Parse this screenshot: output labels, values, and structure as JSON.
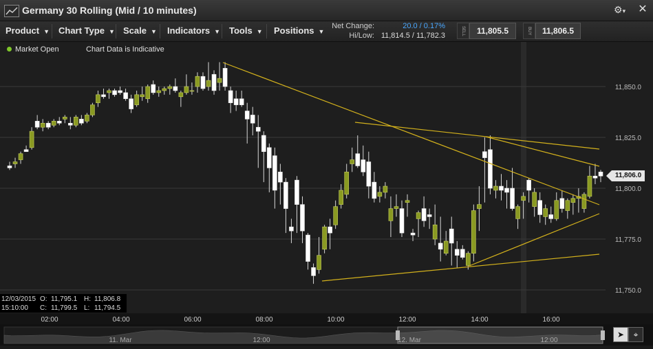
{
  "window": {
    "title": "Germany 30 Rolling (Mid / 10 minutes)",
    "gear_icon": "gear-icon",
    "close_icon": "close-icon"
  },
  "toolbar": {
    "menus": [
      "Product",
      "Chart Type",
      "Scale",
      "Indicators",
      "Tools",
      "Positions"
    ],
    "net_change_label": "Net Change:",
    "net_change_value": "20.0 / 0.17%",
    "hilo_label": "Hi/Low:",
    "hilo_value": "11,814.5 / 11,782.3",
    "sell_tag": "SELL",
    "sell_price": "11,805.5",
    "buy_tag": "BUY",
    "buy_price": "11,806.5"
  },
  "status": {
    "market": "Market Open",
    "indicative": "Chart Data is Indicative"
  },
  "ohlc_panel": {
    "date": "12/03/2015",
    "time": "15:10:00",
    "o_label": "O:",
    "o": "11,795.1",
    "h_label": "H:",
    "h": "11,806.8",
    "c_label": "C:",
    "c": "11,799.5",
    "l_label": "L:",
    "l": "11,794.5"
  },
  "last_price": "11,806.0",
  "navigator": {
    "labels": [
      "11. Mar",
      "12:00",
      "12. Mar",
      "12:00"
    ]
  },
  "colors": {
    "up": "#8a9a22",
    "down": "#ffffff",
    "trendline": "#d4b21c",
    "market_open_dot": "#7fc72a",
    "net_change": "#4aa8ff"
  },
  "chart_data": {
    "type": "candlestick",
    "x_ticks": [
      "02:00",
      "04:00",
      "06:00",
      "08:00",
      "10:00",
      "12:00",
      "14:00",
      "16:00"
    ],
    "y_ticks": [
      "11,850.0",
      "11,825.0",
      "11,800.0",
      "11,775.0",
      "11,750.0"
    ],
    "ylim": [
      11748,
      11863
    ],
    "candles": [
      [
        11811,
        11813,
        11809,
        11810
      ],
      [
        11812,
        11815,
        11810,
        11813
      ],
      [
        11814,
        11818,
        11812,
        11817
      ],
      [
        11819,
        11821,
        11818,
        11818
      ],
      [
        11820,
        11830,
        11819,
        11828
      ],
      [
        11833,
        11836,
        11829,
        11830
      ],
      [
        11830,
        11834,
        11828,
        11832
      ],
      [
        11832,
        11833,
        11829,
        11830
      ],
      [
        11831,
        11834,
        11830,
        11833
      ],
      [
        11833,
        11835,
        11831,
        11832
      ],
      [
        11834,
        11836,
        11832,
        11835
      ],
      [
        11832,
        11835,
        11829,
        11831
      ],
      [
        11831,
        11836,
        11830,
        11835
      ],
      [
        11834,
        11836,
        11831,
        11832
      ],
      [
        11833,
        11837,
        11832,
        11836
      ],
      [
        11836,
        11842,
        11835,
        11841
      ],
      [
        11842,
        11848,
        11840,
        11846
      ],
      [
        11846,
        11849,
        11844,
        11845
      ],
      [
        11847,
        11849,
        11844,
        11848
      ],
      [
        11848,
        11849,
        11845,
        11846
      ],
      [
        11848,
        11850,
        11846,
        11847
      ],
      [
        11847,
        11849,
        11843,
        11844
      ],
      [
        11844,
        11846,
        11837,
        11839
      ],
      [
        11841,
        11848,
        11840,
        11846
      ],
      [
        11845,
        11850,
        11843,
        11846
      ],
      [
        11844,
        11851,
        11842,
        11850
      ],
      [
        11851,
        11853,
        11846,
        11847
      ],
      [
        11847,
        11850,
        11845,
        11848
      ],
      [
        11848,
        11850,
        11846,
        11849
      ],
      [
        11849,
        11851,
        11846,
        11850
      ],
      [
        11850,
        11854,
        11847,
        11848
      ],
      [
        11845,
        11848,
        11840,
        11847
      ],
      [
        11847,
        11856,
        11846,
        11850
      ],
      [
        11848,
        11852,
        11846,
        11848
      ],
      [
        11850,
        11857,
        11847,
        11855
      ],
      [
        11855,
        11857,
        11848,
        11849
      ],
      [
        11850,
        11862,
        11848,
        11853
      ],
      [
        11856,
        11858,
        11846,
        11848
      ],
      [
        11852,
        11862,
        11848,
        11854
      ],
      [
        11859,
        11862,
        11848,
        11850
      ],
      [
        11848,
        11850,
        11837,
        11842
      ],
      [
        11844,
        11848,
        11838,
        11841
      ],
      [
        11844,
        11848,
        11840,
        11841
      ],
      [
        11838,
        11842,
        11822,
        11834
      ],
      [
        11836,
        11840,
        11826,
        11832
      ],
      [
        11830,
        11836,
        11810,
        11828
      ],
      [
        11826,
        11828,
        11803,
        11818
      ],
      [
        11820,
        11822,
        11798,
        11810
      ],
      [
        11816,
        11820,
        11790,
        11799
      ],
      [
        11808,
        11812,
        11792,
        11803
      ],
      [
        11803,
        11805,
        11778,
        11790
      ],
      [
        11781,
        11785,
        11773,
        11779
      ],
      [
        11804,
        11806,
        11778,
        11792
      ],
      [
        11792,
        11796,
        11773,
        11779
      ],
      [
        11777,
        11778,
        11760,
        11764
      ],
      [
        11761,
        11763,
        11753,
        11757
      ],
      [
        11760,
        11776,
        11758,
        11767
      ],
      [
        11770,
        11782,
        11768,
        11781
      ],
      [
        11781,
        11785,
        11770,
        11778
      ],
      [
        11782,
        11794,
        11780,
        11791
      ],
      [
        11792,
        11802,
        11790,
        11799
      ],
      [
        11797,
        11812,
        11795,
        11808
      ],
      [
        11812,
        11820,
        11808,
        11814
      ],
      [
        11817,
        11826,
        11810,
        11811
      ],
      [
        11814,
        11821,
        11806,
        11808
      ],
      [
        11813,
        11818,
        11795,
        11801
      ],
      [
        11803,
        11808,
        11793,
        11795
      ],
      [
        11796,
        11801,
        11793,
        11798
      ],
      [
        11798,
        11803,
        11795,
        11801
      ],
      [
        11784,
        11796,
        11776,
        11790
      ],
      [
        11790,
        11797,
        11786,
        11791
      ],
      [
        11790,
        11794,
        11776,
        11778
      ],
      [
        11793,
        11797,
        11786,
        11794
      ],
      [
        11778,
        11780,
        11774,
        11777
      ],
      [
        11785,
        11789,
        11776,
        11788
      ],
      [
        11790,
        11796,
        11781,
        11784
      ],
      [
        11787,
        11790,
        11780,
        11786
      ],
      [
        11775,
        11792,
        11772,
        11782
      ],
      [
        11773,
        11786,
        11764,
        11770
      ],
      [
        11768,
        11779,
        11767,
        11774
      ],
      [
        11780,
        11786,
        11762,
        11773
      ],
      [
        11770,
        11774,
        11761,
        11767
      ],
      [
        11770,
        11772,
        11765,
        11766
      ],
      [
        11762,
        11769,
        11760,
        11768
      ],
      [
        11768,
        11792,
        11764,
        11789
      ],
      [
        11790,
        11801,
        11779,
        11792
      ],
      [
        11818,
        11825,
        11793,
        11815
      ],
      [
        11819,
        11826,
        11797,
        11800
      ],
      [
        11799,
        11804,
        11795,
        11801
      ],
      [
        11801,
        11807,
        11794,
        11799
      ],
      [
        11800,
        11804,
        11790,
        11798
      ],
      [
        11800,
        11810,
        11789,
        11790
      ],
      [
        11785,
        11792,
        11780,
        11791
      ],
      [
        11794,
        11798,
        11785,
        11796
      ],
      [
        11804,
        11805,
        11793,
        11799
      ],
      [
        11791,
        11800,
        11786,
        11798
      ],
      [
        11794,
        11798,
        11783,
        11787
      ],
      [
        11786,
        11792,
        11782,
        11790
      ],
      [
        11787,
        11791,
        11783,
        11785
      ],
      [
        11785,
        11798,
        11784,
        11794
      ],
      [
        11795,
        11799,
        11788,
        11790
      ],
      [
        11789,
        11795,
        11785,
        11794
      ],
      [
        11793,
        11797,
        11787,
        11795
      ],
      [
        11795,
        11800,
        11788,
        11796
      ],
      [
        11790,
        11798,
        11788,
        11797
      ],
      [
        11796,
        11811,
        11795,
        11806
      ],
      [
        11806,
        11812,
        11802,
        11805
      ],
      [
        11808,
        11809,
        11803,
        11806
      ]
    ],
    "trendlines": [
      {
        "x1": 324,
        "y1": 91,
        "x2": 706,
        "y2": 199,
        "x2e": 871,
        "y2e": 298
      },
      {
        "x1": 516,
        "y1": 178,
        "x2": 706,
        "y2": 199,
        "x2e": 871,
        "y2e": 217
      },
      {
        "x1": 706,
        "y1": 199,
        "x2e": 871,
        "y2e": 242
      },
      {
        "x1": 682,
        "y1": 387,
        "x2e": 871,
        "y2e": 311
      },
      {
        "x1": 468,
        "y1": 409,
        "x2e": 871,
        "y2e": 370
      }
    ]
  }
}
